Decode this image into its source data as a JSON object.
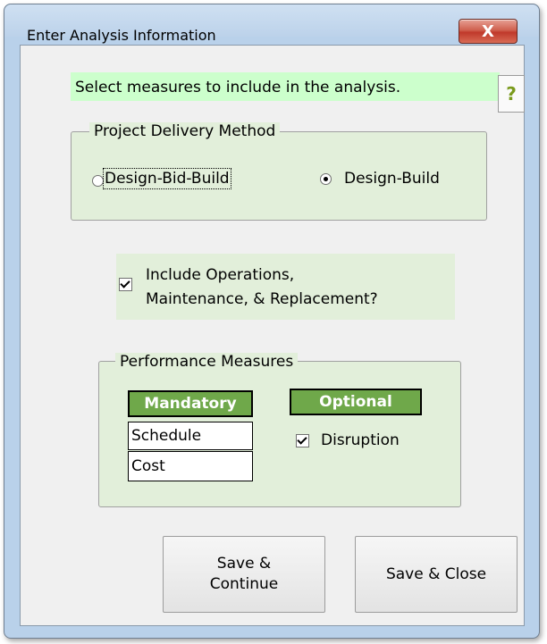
{
  "window": {
    "title": "Enter Analysis Information",
    "close_label": "X"
  },
  "header": {
    "instruction": "Select measures to include in the analysis.",
    "help_label": "?"
  },
  "delivery": {
    "legend": "Project Delivery Method",
    "options": [
      {
        "label": "Design-Bid-Build",
        "selected": false
      },
      {
        "label": "Design-Build",
        "selected": true
      }
    ]
  },
  "om": {
    "label_line1": "Include Operations,",
    "label_line2": "Maintenance, & Replacement?",
    "checked": true
  },
  "performance": {
    "legend": "Performance Measures",
    "mandatory_header": "Mandatory",
    "mandatory_items": [
      "Schedule",
      "Cost"
    ],
    "optional_header": "Optional",
    "optional_items": [
      {
        "label": "Disruption",
        "checked": true
      }
    ]
  },
  "buttons": {
    "save_continue": "Save &\nContinue",
    "save_close": "Save & Close"
  },
  "colors": {
    "group_bg": "#e2efda",
    "header_bg": "#ccffcc",
    "table_header_bg": "#6fa84a",
    "close_button": "#c0392b"
  }
}
